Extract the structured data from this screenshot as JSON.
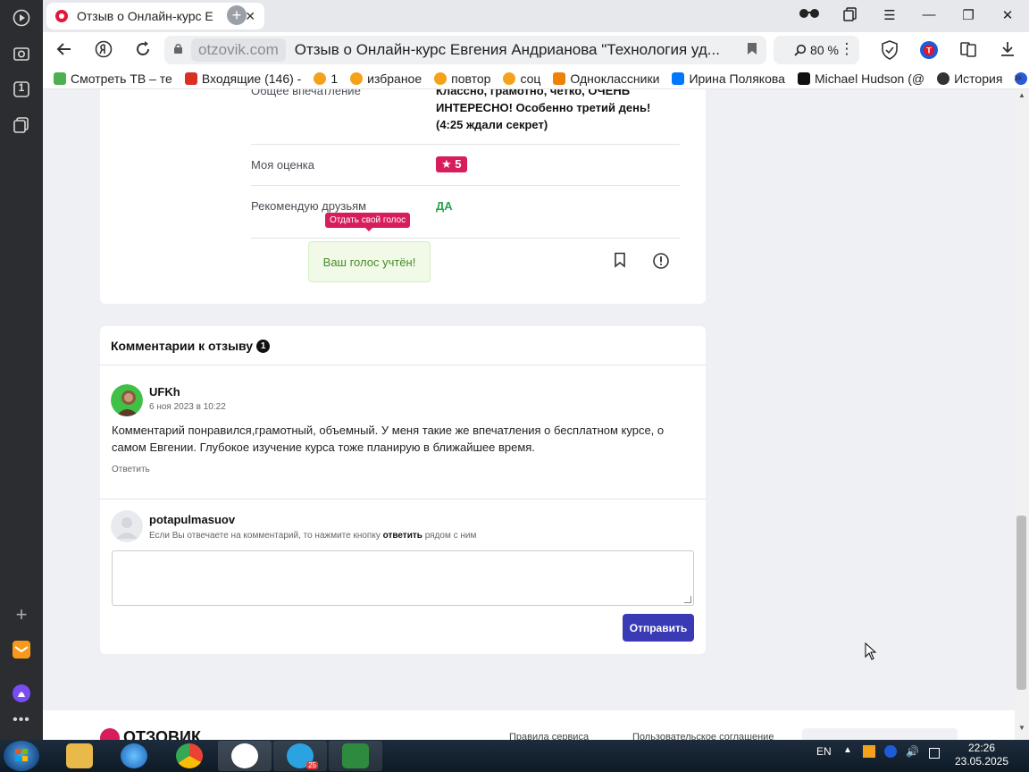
{
  "browser": {
    "tab_title": "Отзыв о Онлайн-курс Е",
    "tab_close": "✕",
    "new_tab": "+",
    "domain": "otzovik.com",
    "page_title": "Отзыв о Онлайн-курс Евгения Андрианова \"Технология уд...",
    "zoom": "80 %",
    "window_controls": [
      "minimize",
      "restore",
      "close"
    ]
  },
  "sidebar": {
    "items": [
      "play-icon",
      "camera-icon",
      "one-icon",
      "copy-icon",
      "add-icon",
      "mail-icon",
      "alice-icon",
      "more-icon"
    ],
    "badge_one": "1"
  },
  "bookmarks": [
    {
      "label": "Смотреть ТВ – те",
      "color": "#4caf50"
    },
    {
      "label": "Входящие (146) -",
      "color": "#d93025"
    },
    {
      "label": "1",
      "color": "#f4a11b"
    },
    {
      "label": "избраное",
      "color": "#f4a11b"
    },
    {
      "label": "повтор",
      "color": "#f4a11b"
    },
    {
      "label": "соц",
      "color": "#f4a11b"
    },
    {
      "label": "Одноклассники",
      "color": "#ee8208"
    },
    {
      "label": "Ирина Полякова",
      "color": "#0077ff"
    },
    {
      "label": "Michael Hudson (@",
      "color": "#111111"
    },
    {
      "label": "История",
      "color": "#333333"
    }
  ],
  "review": {
    "impression_label": "Общее впечатление",
    "impression_value": "Классно, грамотно, четко, ОЧЕНЬ ИНТЕРЕСНО! Особенно третий день! (4:25 ждали секрет)",
    "rating_label": "Моя оценка",
    "rating_value": "★ 5",
    "recommend_label": "Рекомендую друзьям",
    "recommend_value": "ДА",
    "vote_tooltip": "Отдать свой голос",
    "vote_done": "Ваш голос учтён!"
  },
  "comments": {
    "header": "Комментарии к отзыву",
    "count": "1",
    "items": [
      {
        "user": "UFKh",
        "date": "6 ноя 2023 в 10:22",
        "text": "Комментарий понравился,грамотный, объемный. У меня такие же впечатления о бесплатном курсе, о самом Евгении. Глубокое изучение курса тоже планирую в ближайшее время.",
        "reply": "Ответить"
      }
    ],
    "current_user": "potapulmasuov",
    "hint_before": "Если Вы отвечаете на комментарий, то нажмите кнопку",
    "hint_bold": "ответить",
    "hint_after": "рядом с ним",
    "textarea_value": "",
    "send": "Отправить"
  },
  "footer": {
    "logo": "ОТЗОВИК",
    "link1": "Правила сервиса",
    "link2": "Пользовательское соглашение"
  },
  "taskbar": {
    "lang": "EN",
    "time": "22:26",
    "date": "23.05.2025",
    "telegram_badge": "25"
  },
  "colors": {
    "accent": "#d81d5c",
    "send_button": "#3a3ab5",
    "recommend_green": "#2aa24a"
  }
}
